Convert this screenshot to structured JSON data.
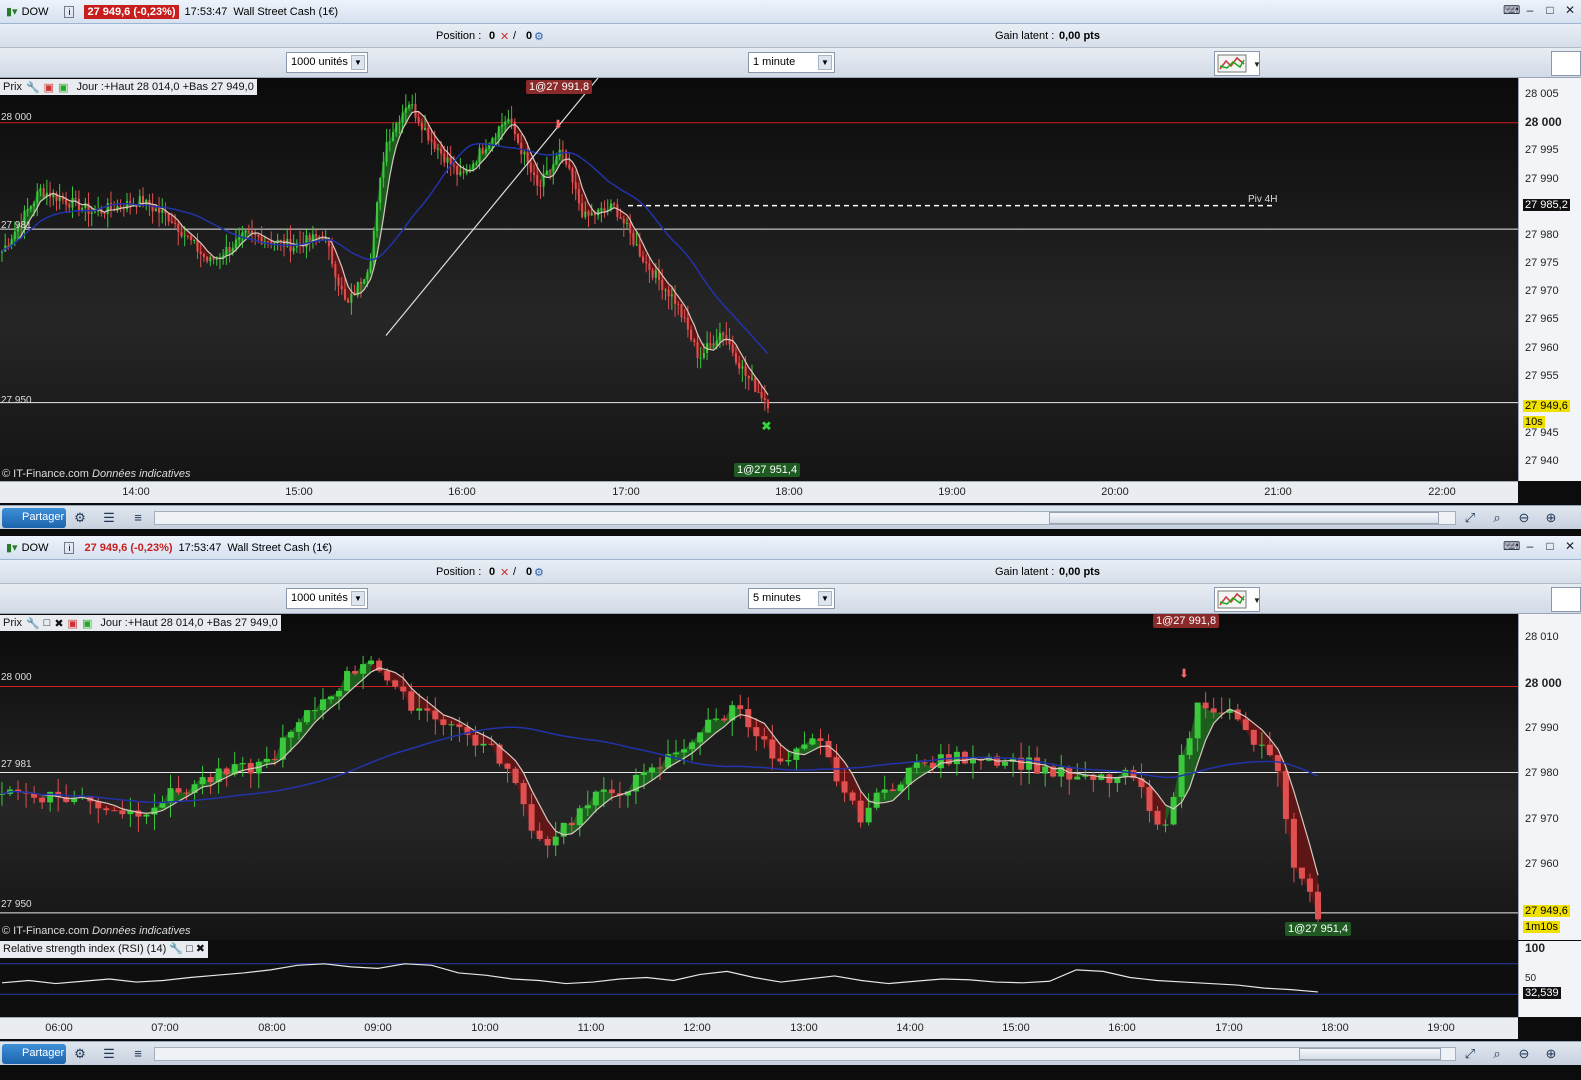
{
  "window1": {
    "symbol": "DOW",
    "price_change": "27 949,6 (-0,23%)",
    "time": "17:53:47",
    "instrument": "Wall Street Cash (1€)",
    "position_label": "Position :",
    "position_value": "0",
    "position_value2": "0",
    "gain_label": "Gain latent :",
    "gain_value": "0,00 pts",
    "units_select": "1000 unités",
    "interval_select": "1 minute",
    "overlay_title": "Prix",
    "overlay_info": "Jour :+Haut 28 014,0 +Bas 27 949,0",
    "trade_tag_top": "1@27 991,8",
    "trade_tag_bottom": "1@27 951,4",
    "line_label_28000": "28 000",
    "line_label_27981": "27 981",
    "line_label_27950": "27 950",
    "pivot_label": "Piv 4H",
    "copyright": "© IT-Finance.com",
    "copyright_note": "Données indicatives",
    "axis_ticks": [
      "28 005",
      "28 000",
      "27 995",
      "27 990",
      "27 985,2",
      "27 980",
      "27 975",
      "27 970",
      "27 965",
      "27 960",
      "27 955",
      "27 949,6",
      "27 945",
      "27 940"
    ],
    "countdown": "10s",
    "time_labels": [
      "14:00",
      "15:00",
      "16:00",
      "17:00",
      "18:00",
      "19:00",
      "20:00",
      "21:00",
      "22:00"
    ],
    "share_label": "Partager"
  },
  "window2": {
    "symbol": "DOW",
    "price_change": "27 949,6 (-0,23%)",
    "time": "17:53:47",
    "instrument": "Wall Street Cash (1€)",
    "position_label": "Position :",
    "position_value": "0",
    "position_value2": "0",
    "gain_label": "Gain latent :",
    "gain_value": "0,00 pts",
    "units_select": "1000 unités",
    "interval_select": "5 minutes",
    "overlay_title": "Prix",
    "overlay_info": "Jour :+Haut 28 014,0 +Bas 27 949,0",
    "trade_tag_top": "1@27 991,8",
    "trade_tag_bottom": "1@27 951,4",
    "line_label_28000": "28 000",
    "line_label_27981": "27 981",
    "line_label_27950": "27 950",
    "copyright": "© IT-Finance.com",
    "copyright_note": "Données indicatives",
    "axis_ticks": [
      "28 010",
      "28 000",
      "27 990",
      "27 980",
      "27 970",
      "27 960",
      "27 949,6"
    ],
    "countdown": "1m10s",
    "rsi_title": "Relative strength index (RSI) (14)",
    "rsi_ticks": [
      "100",
      "50",
      "32,539"
    ],
    "time_labels": [
      "06:00",
      "07:00",
      "08:00",
      "09:00",
      "10:00",
      "11:00",
      "12:00",
      "13:00",
      "14:00",
      "15:00",
      "16:00",
      "17:00",
      "18:00",
      "19:00"
    ],
    "share_label": "Partager"
  },
  "colors": {
    "bull": "#3cc83c",
    "bear": "#e05050",
    "ma_blue": "#2233aa",
    "ma_light": "#d8c8c0",
    "red_line": "#d02020"
  },
  "chart_data": [
    {
      "type": "candlestick",
      "interval": "1 minute",
      "x_range": [
        "13:45",
        "22:10"
      ],
      "y_range": [
        27936,
        28008
      ],
      "levels": [
        28000,
        27981,
        27950
      ],
      "pivot": {
        "label": "Piv 4H",
        "value": 27985.2
      },
      "last_price": 27949.6,
      "close_path": [
        [
          0,
          27977
        ],
        [
          0.05,
          27988
        ],
        [
          0.12,
          27984
        ],
        [
          0.18,
          27986
        ],
        [
          0.22,
          27983
        ],
        [
          0.27,
          27975
        ],
        [
          0.32,
          27980
        ],
        [
          0.38,
          27978
        ],
        [
          0.42,
          27980
        ],
        [
          0.45,
          27967
        ],
        [
          0.48,
          27975
        ],
        [
          0.5,
          27996
        ],
        [
          0.53,
          28004
        ],
        [
          0.56,
          27997
        ],
        [
          0.6,
          27990
        ],
        [
          0.63,
          27996
        ],
        [
          0.66,
          28001
        ],
        [
          0.7,
          27988
        ],
        [
          0.73,
          27995
        ],
        [
          0.76,
          27983
        ],
        [
          0.8,
          27985
        ],
        [
          0.84,
          27975
        ],
        [
          0.88,
          27968
        ],
        [
          0.91,
          27958
        ],
        [
          0.94,
          27963
        ],
        [
          0.97,
          27955
        ],
        [
          1.0,
          27950
        ]
      ]
    },
    {
      "type": "candlestick",
      "interval": "5 minutes",
      "x_range": [
        "05:35",
        "19:10"
      ],
      "y_range": [
        27944,
        28016
      ],
      "levels": [
        28000,
        27981,
        27950
      ],
      "last_price": 27949.6,
      "close_path": [
        [
          0,
          27977
        ],
        [
          0.06,
          27975
        ],
        [
          0.1,
          27972
        ],
        [
          0.15,
          27979
        ],
        [
          0.2,
          27983
        ],
        [
          0.24,
          27996
        ],
        [
          0.28,
          28007
        ],
        [
          0.3,
          27998
        ],
        [
          0.34,
          27992
        ],
        [
          0.38,
          27984
        ],
        [
          0.41,
          27965
        ],
        [
          0.45,
          27975
        ],
        [
          0.49,
          27980
        ],
        [
          0.53,
          27990
        ],
        [
          0.56,
          27996
        ],
        [
          0.59,
          27982
        ],
        [
          0.62,
          27988
        ],
        [
          0.65,
          27971
        ],
        [
          0.69,
          27982
        ],
        [
          0.74,
          27985
        ],
        [
          0.78,
          27983
        ],
        [
          0.82,
          27979
        ],
        [
          0.86,
          27980
        ],
        [
          0.88,
          27967
        ],
        [
          0.91,
          27997
        ],
        [
          0.93,
          27995
        ],
        [
          0.95,
          27988
        ],
        [
          0.97,
          27982
        ],
        [
          0.98,
          27960
        ],
        [
          0.99,
          27955
        ],
        [
          1.0,
          27950
        ]
      ]
    },
    {
      "type": "line",
      "title": "Relative strength index (RSI) (14)",
      "y_range": [
        0,
        100
      ],
      "last_value": 32.539,
      "values": [
        45,
        48,
        44,
        47,
        50,
        46,
        48,
        52,
        55,
        58,
        62,
        68,
        70,
        66,
        64,
        70,
        68,
        58,
        55,
        50,
        48,
        44,
        46,
        50,
        52,
        48,
        56,
        60,
        52,
        46,
        50,
        54,
        48,
        44,
        47,
        50,
        49,
        46,
        45,
        47,
        62,
        60,
        52,
        48,
        46,
        44,
        42,
        38,
        36,
        33
      ]
    }
  ]
}
